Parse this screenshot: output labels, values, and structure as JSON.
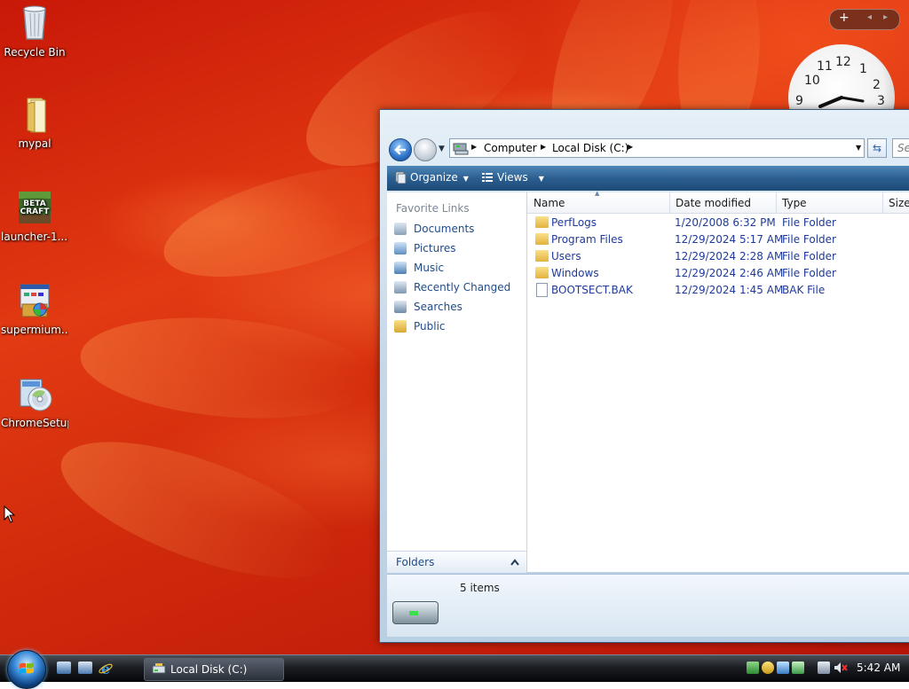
{
  "desktop": {
    "icons": [
      {
        "label": "Recycle Bin",
        "icon": "recycle-bin-icon"
      },
      {
        "label": "mypal",
        "icon": "folder-icon"
      },
      {
        "label": "launcher-1....",
        "icon": "betacraft-icon"
      },
      {
        "label": "supermium...",
        "icon": "installer-icon"
      },
      {
        "label": "ChromeSetup",
        "icon": "setup-disc-icon"
      }
    ]
  },
  "gadgets": {
    "add_symbol": "+",
    "clock_numbers": [
      "12",
      "1",
      "2",
      "3",
      "9",
      "10",
      "11"
    ]
  },
  "explorer": {
    "breadcrumb": [
      "Computer",
      "Local Disk (C:)"
    ],
    "search_placeholder": "Search",
    "toolbar": {
      "organize": "Organize",
      "views": "Views"
    },
    "favorites_heading": "Favorite Links",
    "favorites": [
      {
        "label": "Documents",
        "icon": "documents-icon"
      },
      {
        "label": "Pictures",
        "icon": "pictures-icon"
      },
      {
        "label": "Music",
        "icon": "music-icon"
      },
      {
        "label": "Recently Changed",
        "icon": "recently-changed-icon"
      },
      {
        "label": "Searches",
        "icon": "searches-icon"
      },
      {
        "label": "Public",
        "icon": "public-folder-icon"
      }
    ],
    "folders_label": "Folders",
    "columns": [
      "Name",
      "Date modified",
      "Type",
      "Size"
    ],
    "files": [
      {
        "name": "PerfLogs",
        "date": "1/20/2008 6:32 PM",
        "type": "File Folder",
        "kind": "folder"
      },
      {
        "name": "Program Files",
        "date": "12/29/2024 5:17 AM",
        "type": "File Folder",
        "kind": "folder"
      },
      {
        "name": "Users",
        "date": "12/29/2024 2:28 AM",
        "type": "File Folder",
        "kind": "folder"
      },
      {
        "name": "Windows",
        "date": "12/29/2024 2:46 AM",
        "type": "File Folder",
        "kind": "folder"
      },
      {
        "name": "BOOTSECT.BAK",
        "date": "12/29/2024 1:45 AM",
        "type": "BAK File",
        "kind": "file"
      }
    ],
    "status": "5 items"
  },
  "taskbar": {
    "task_label": "Local Disk (C:)",
    "time": "5:42 AM"
  },
  "colors": {
    "link": "#1f4b8a",
    "file_text": "#1f3a9a",
    "wallpaper": "#d02a0c"
  }
}
